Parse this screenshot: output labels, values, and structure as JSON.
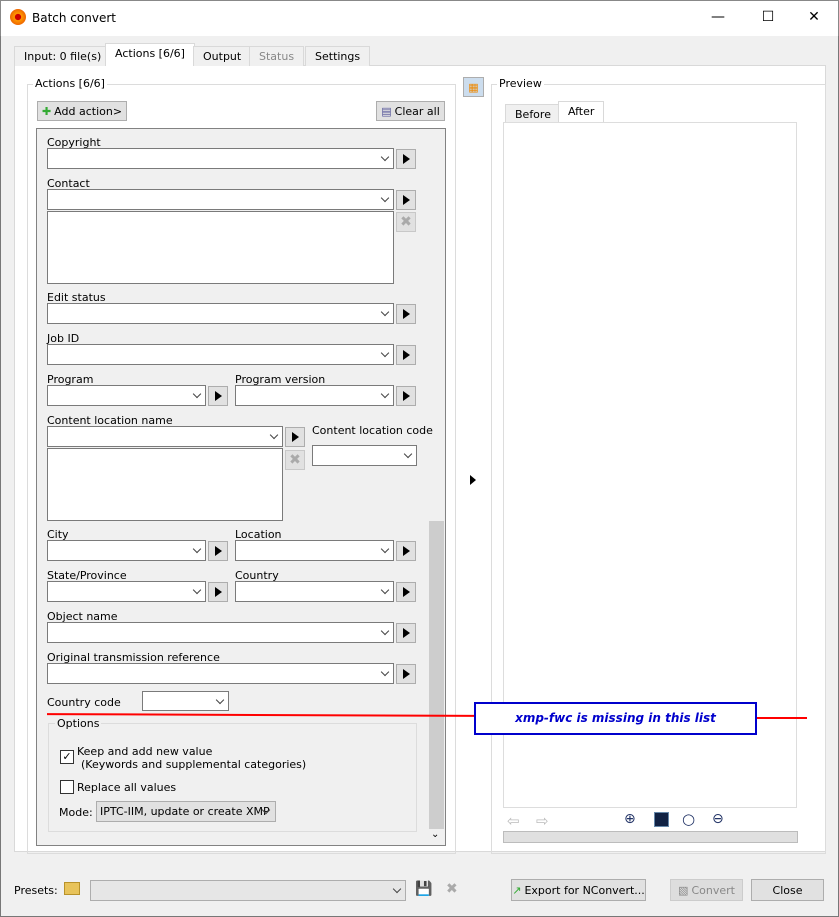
{
  "window": {
    "title": "Batch convert"
  },
  "tabs": [
    "Input: 0 file(s)",
    "Actions [6/6]",
    "Output",
    "Status",
    "Settings"
  ],
  "actions": {
    "group_label": "Actions [6/6]",
    "add_action": "Add action>",
    "clear_all": "Clear all"
  },
  "fields": {
    "copyright": "Copyright",
    "contact": "Contact",
    "edit_status": "Edit status",
    "job_id": "Job ID",
    "program": "Program",
    "program_version": "Program version",
    "content_location_name": "Content location name",
    "content_location_code": "Content location code",
    "city": "City",
    "location": "Location",
    "state": "State/Province",
    "country": "Country",
    "object_name": "Object name",
    "original_transmission_reference": "Original transmission reference",
    "country_code": "Country code"
  },
  "options": {
    "label": "Options",
    "keep_add": "Keep and add new value",
    "keep_add_sub": "(Keywords and supplemental categories)",
    "keep_add_checked": true,
    "replace_all": "Replace all values",
    "replace_all_checked": false,
    "mode_label": "Mode:",
    "mode_value": "IPTC-IIM, update or create XMP"
  },
  "annotation": {
    "text": "xmp-fwc is missing in this list",
    "color": "#ff0000",
    "text_color": "#0000cc"
  },
  "preview": {
    "label": "Preview",
    "tabs": [
      "Before",
      "After"
    ]
  },
  "footer": {
    "presets_label": "Presets:",
    "export": "Export for NConvert...",
    "convert": "Convert",
    "close": "Close"
  }
}
